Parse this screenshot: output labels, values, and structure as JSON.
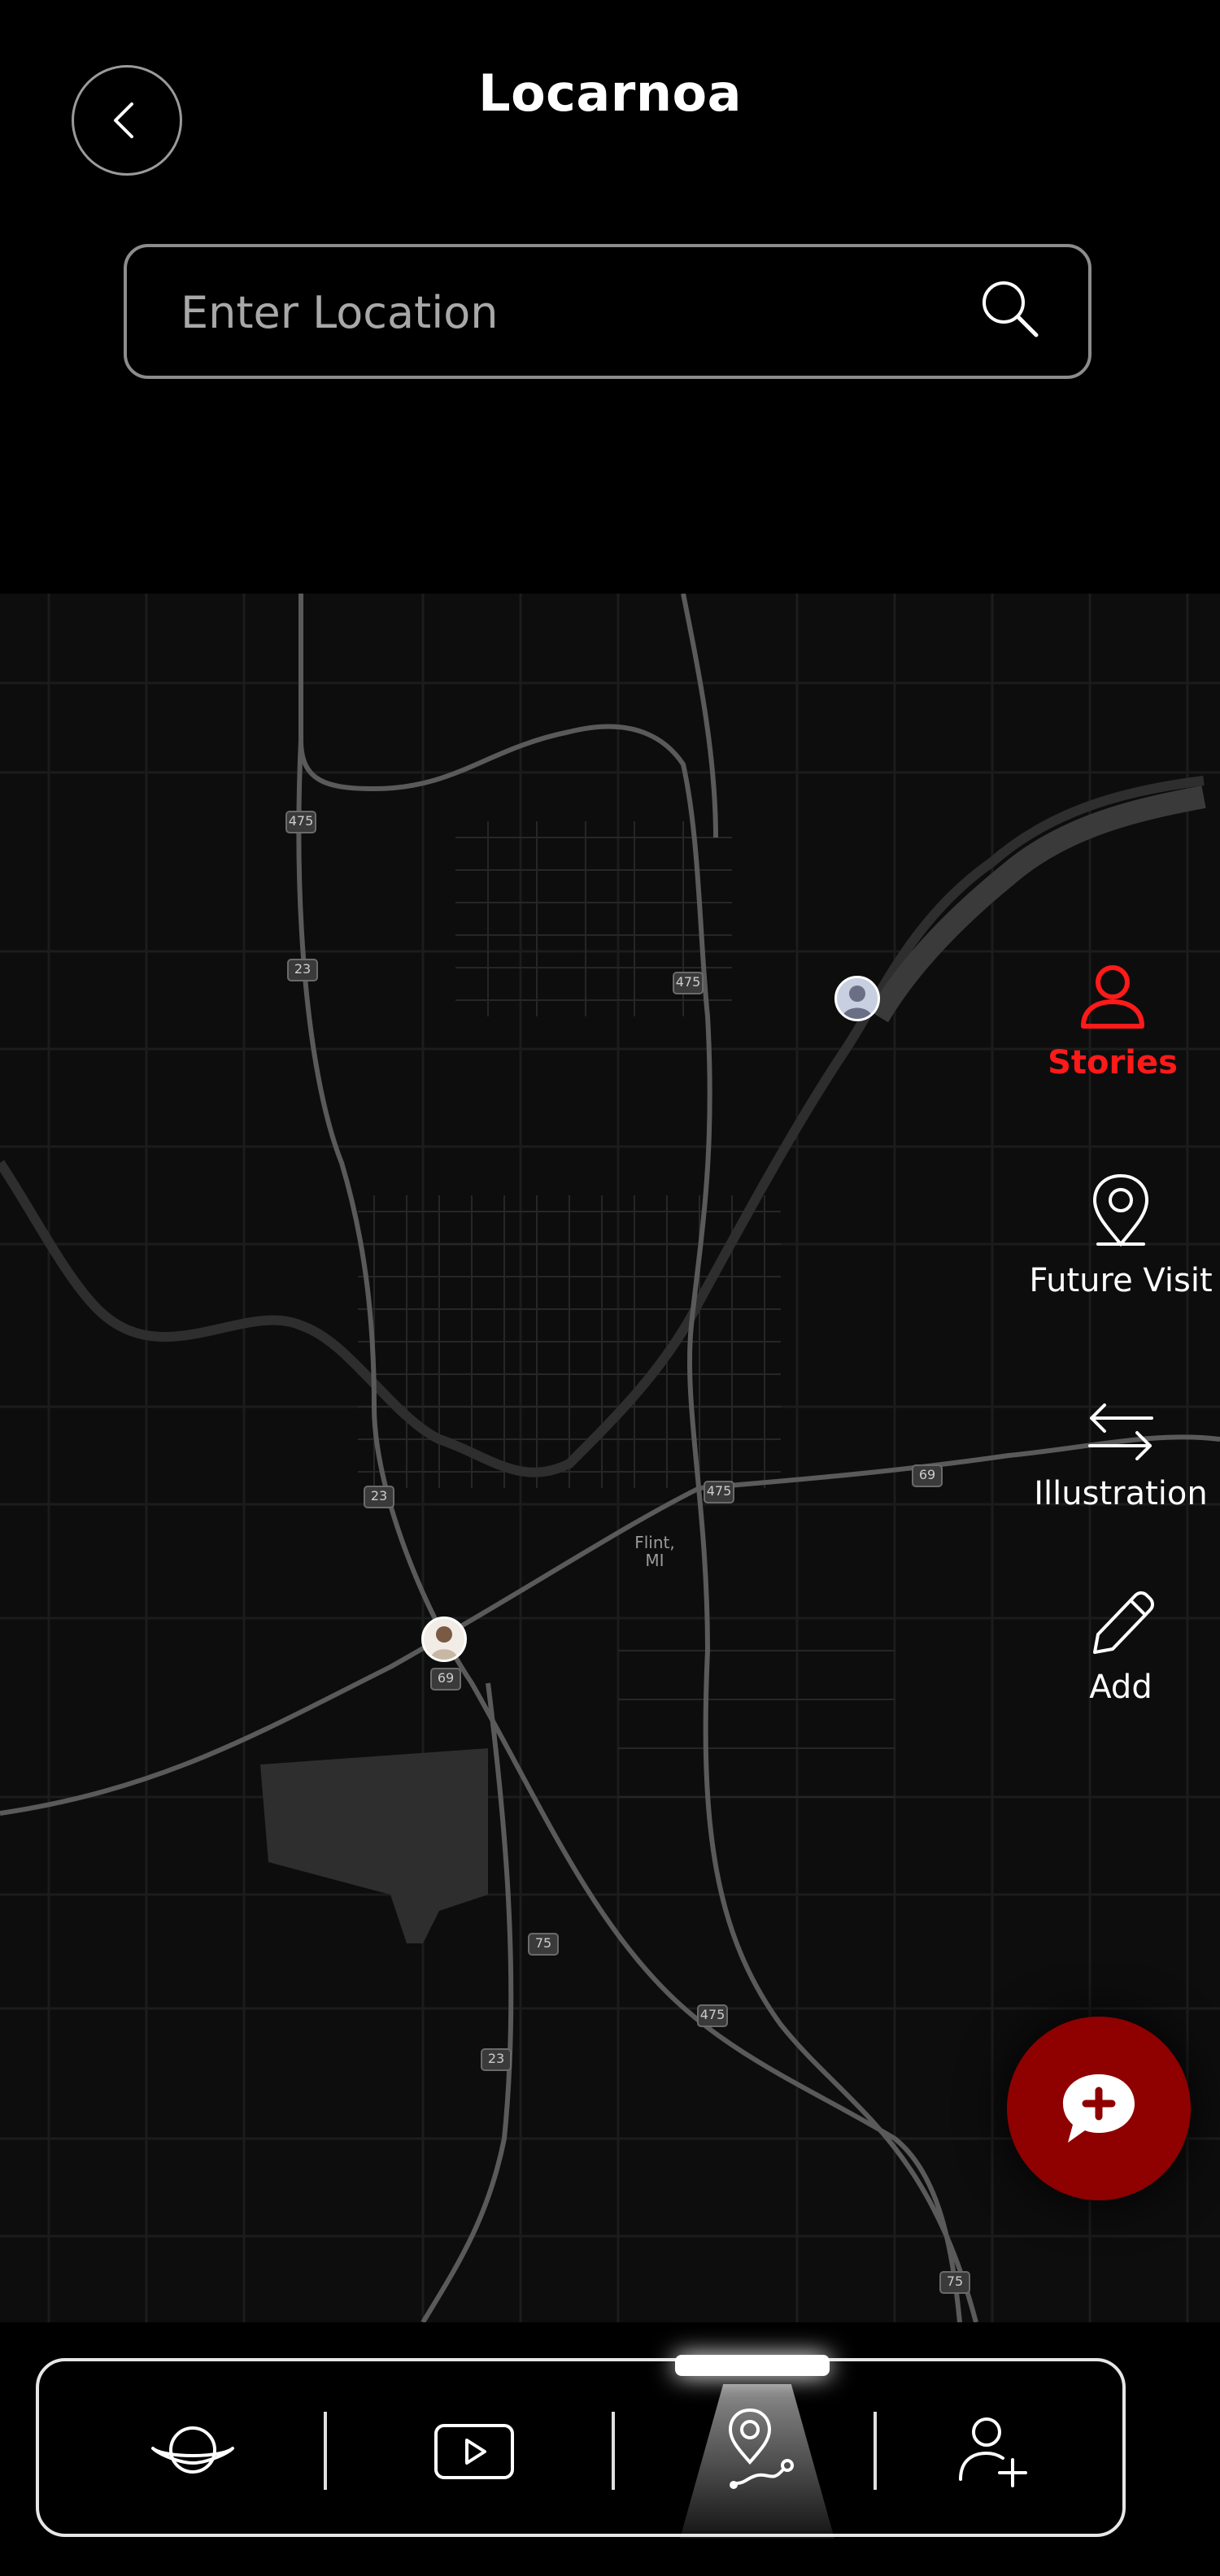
{
  "header": {
    "title": "Locarnoa",
    "back_icon": "chevron-left-icon"
  },
  "search": {
    "placeholder": "Enter Location",
    "value": "",
    "icon": "search-icon"
  },
  "map": {
    "labels": [
      {
        "text": "475"
      },
      {
        "text": "23"
      },
      {
        "text": "475"
      },
      {
        "text": "23"
      },
      {
        "text": "475"
      },
      {
        "text": "69"
      },
      {
        "text": "69"
      },
      {
        "text": "75"
      },
      {
        "text": "475"
      },
      {
        "text": "23"
      },
      {
        "text": "75"
      }
    ],
    "city": {
      "line1": "Flint,",
      "line2": "MI"
    },
    "markers": [
      {
        "name": "user-avatar-marker"
      },
      {
        "name": "user-avatar-marker"
      }
    ]
  },
  "actions": [
    {
      "label": "Stories",
      "icon": "person-icon",
      "active": true
    },
    {
      "label": "Future Visit",
      "icon": "location-pin-icon",
      "active": false
    },
    {
      "label": "Illustration",
      "icon": "arrows-exchange-icon",
      "active": false
    },
    {
      "label": "Add",
      "icon": "pencil-icon",
      "active": false
    }
  ],
  "fab": {
    "icon": "chat-add-icon"
  },
  "nav": {
    "items": [
      {
        "icon": "planet-icon"
      },
      {
        "icon": "video-play-icon"
      },
      {
        "icon": "map-route-icon",
        "active": true
      },
      {
        "icon": "add-user-icon"
      }
    ]
  },
  "colors": {
    "accent": "#ff1a1a",
    "fab": "#8f0000",
    "background": "#000000",
    "map": "#0d0d0d"
  }
}
